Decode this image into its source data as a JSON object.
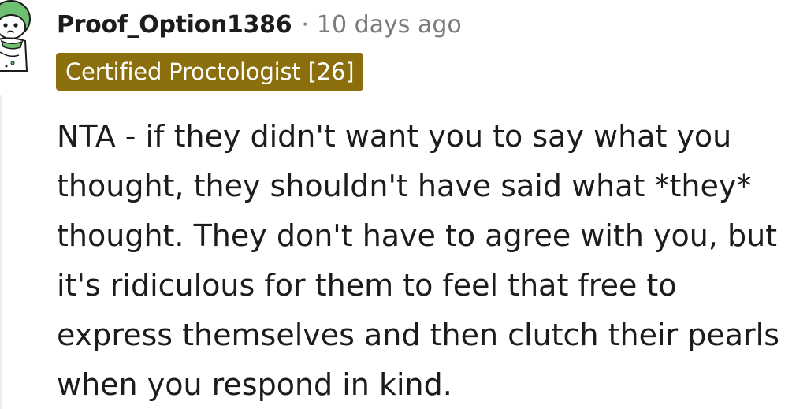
{
  "comment": {
    "author": "Proof_Option1386",
    "separator": "·",
    "timestamp": "10 days ago",
    "flair": "Certified Proctologist [26]",
    "body_lines": [
      "NTA - if they didn't want you to say what you",
      "thought, they shouldn't have said what *they*",
      "thought. They don't have to agree with you, but",
      "it's ridiculous for them to feel that free to",
      "express themselves and then clutch their pearls",
      "when you respond in kind."
    ]
  },
  "colors": {
    "flair_background": "#8b6f0d",
    "flair_text": "#ffffff",
    "meta_text": "#7c7c7c",
    "body_text": "#1c1c1c",
    "avatar_helmet": "#6fbf73"
  },
  "icons": {
    "avatar": "snoo-avatar-green-helmet"
  }
}
